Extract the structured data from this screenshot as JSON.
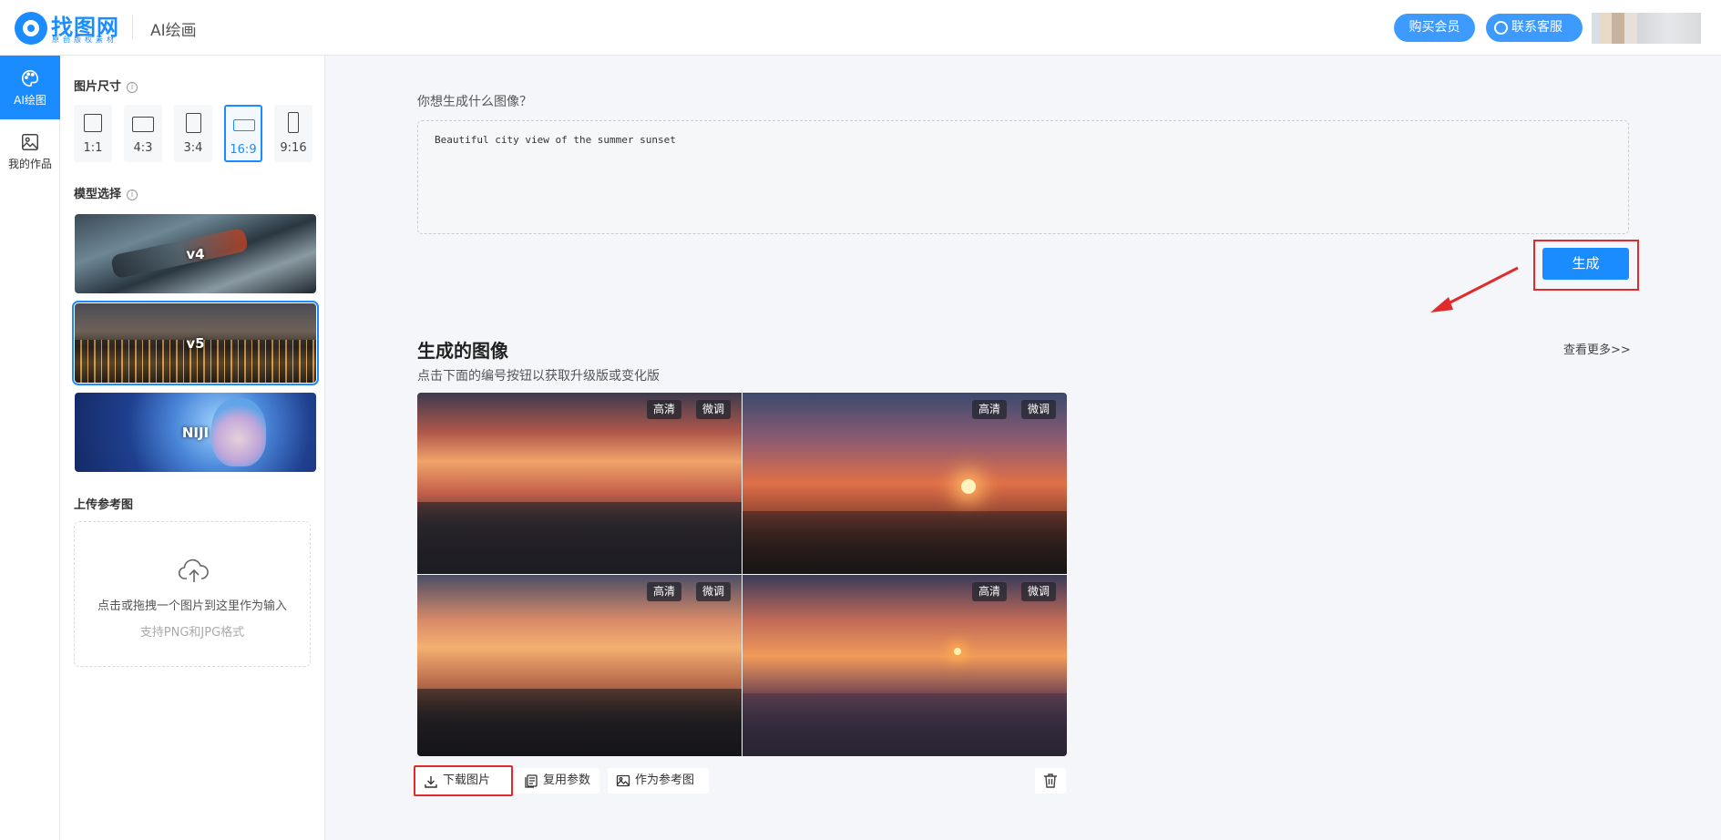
{
  "header": {
    "brand": "找图网",
    "brand_sub": "原创版权素材",
    "title": "AI绘画",
    "vip_button": "购买会员",
    "service_button": "联系客服"
  },
  "nav": {
    "items": [
      {
        "label": "AI绘图",
        "icon": "palette-icon",
        "active": true
      },
      {
        "label": "我的作品",
        "icon": "image-icon",
        "active": false
      }
    ]
  },
  "settings": {
    "size_title": "图片尺寸",
    "ratios": [
      "1:1",
      "4:3",
      "3:4",
      "16:9",
      "9:16"
    ],
    "selected_ratio": "16:9",
    "model_title": "模型选择",
    "models": [
      "v4",
      "v5",
      "NIJI"
    ],
    "selected_model": "v5",
    "upload_title": "上传参考图",
    "upload_hint": "点击或拖拽一个图片到这里作为输入",
    "upload_formats": "支持PNG和JPG格式"
  },
  "prompt": {
    "label": "你想生成什么图像？",
    "value": "Beautiful city view of the summer sunset",
    "generate_button": "生成"
  },
  "results": {
    "title": "生成的图像",
    "subtitle": "点击下面的编号按钮以获取升级版或变化版",
    "more_link": "查看更多>>",
    "tag_hd": "高清",
    "tag_tweak": "微调",
    "actions": {
      "download": "下载图片",
      "reuse": "复用参数",
      "as_reference": "作为参考图"
    }
  },
  "colors": {
    "accent": "#1a8cff",
    "highlight_red": "#e12b2b"
  }
}
